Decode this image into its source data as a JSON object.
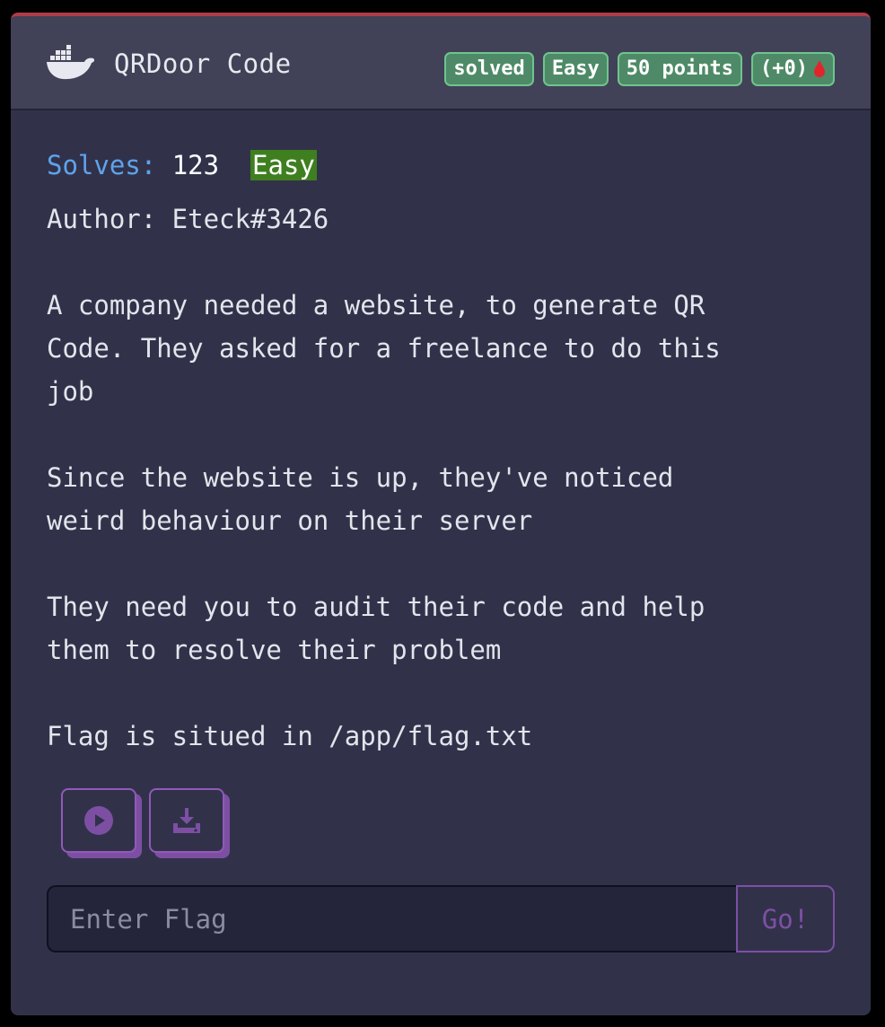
{
  "header": {
    "title": "QRDoor Code",
    "icon": "docker-icon",
    "badges": {
      "status": "solved",
      "difficulty": "Easy",
      "points": "50 points",
      "bonus": "(+0)"
    }
  },
  "stats": {
    "solves_label": "Solves:",
    "solves_value": "123",
    "difficulty": "Easy"
  },
  "author": "Author: Eteck#3426",
  "description": [
    "A company needed a website, to generate QR",
    "Code. They asked for a freelance to do this",
    "job",
    "",
    "Since the website is up, they've noticed",
    "weird behaviour on their server",
    "",
    "They need you to audit their code and help",
    "them to resolve their problem",
    "",
    "Flag is situed in /app/flag.txt"
  ],
  "actions": {
    "start_icon": "play-icon",
    "download_icon": "download-icon"
  },
  "flag_form": {
    "placeholder": "Enter Flag",
    "value": "",
    "submit_label": "Go!"
  },
  "colors": {
    "card_accent": "#b03b48",
    "badge_green": "#4e8a67",
    "solves_blue": "#5fa3ea",
    "easy_green": "#3f7f1f",
    "button_purple": "#7d4fa3",
    "drop_red": "#e0252c"
  }
}
